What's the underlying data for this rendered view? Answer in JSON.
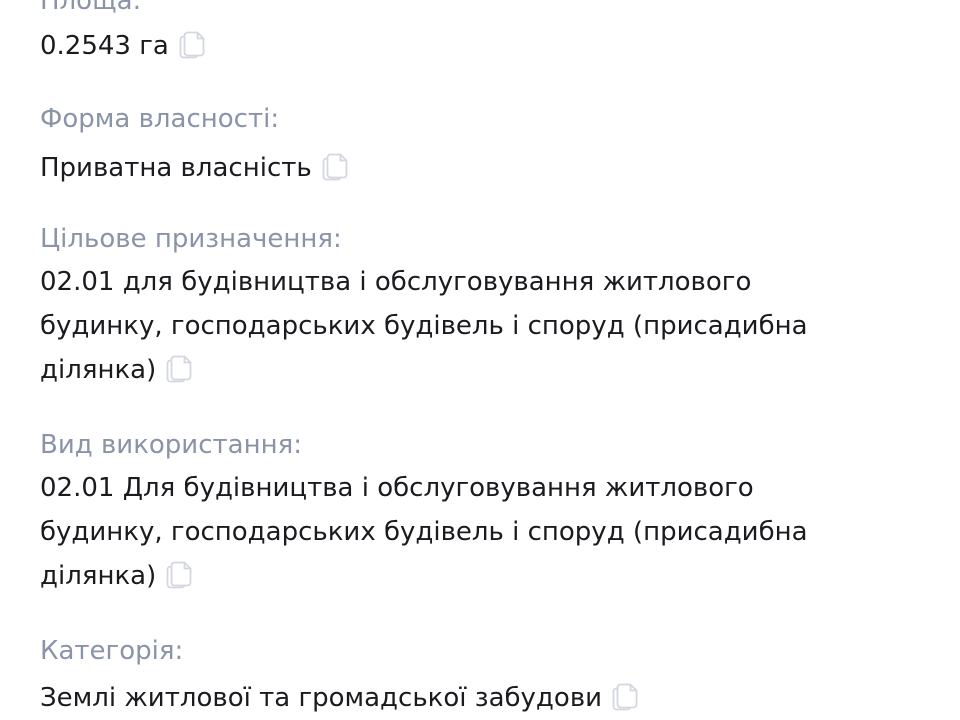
{
  "fields": [
    {
      "label": "Площа:",
      "value": "0.2543 га",
      "icon": "copy-icon"
    },
    {
      "label": "Форма власності:",
      "value": "Приватна власність",
      "icon": "copy-icon"
    },
    {
      "label": "Цільове призначення:",
      "value": "02.01 для будівництва і обслуговування житлового будинку, господарських будівель і споруд (присадибна ділянка)",
      "icon": "copy-icon"
    },
    {
      "label": "Вид використання:",
      "value": "02.01 Для будівництва і обслуговування житлового будинку, господарських будівель і споруд (присадибна ділянка)",
      "icon": "copy-icon"
    },
    {
      "label": "Категорія:",
      "value": "Землі житлової та громадської забудови",
      "icon": "copy-icon"
    }
  ],
  "colors": {
    "label": "#8a93a8",
    "value": "#1b1b1f",
    "icon": "#d4d7df"
  }
}
